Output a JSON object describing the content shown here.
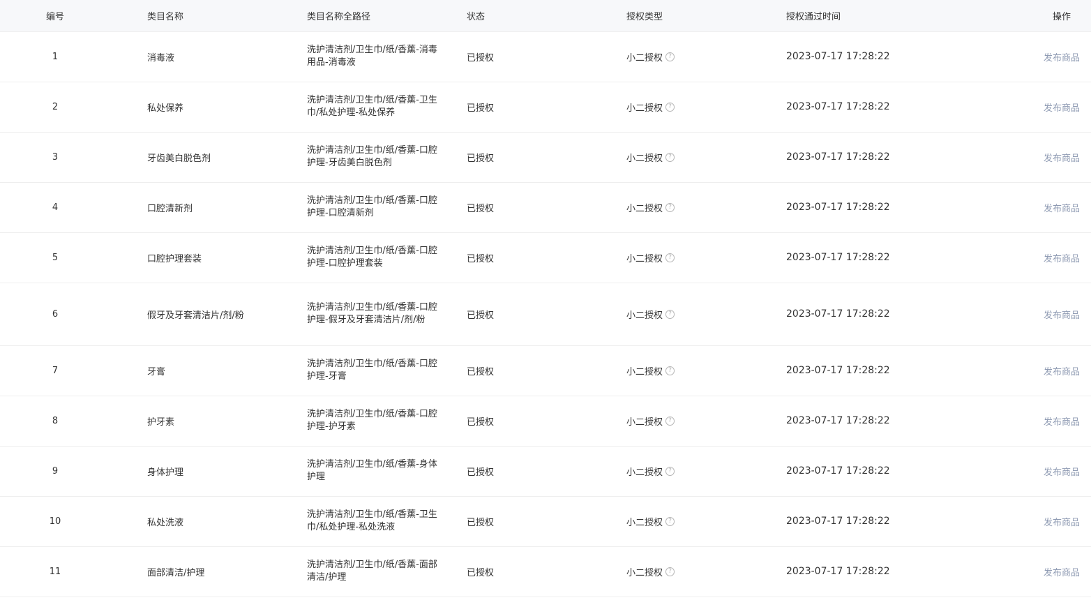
{
  "table": {
    "headers": {
      "no": "编号",
      "name": "类目名称",
      "path": "类目名称全路径",
      "status": "状态",
      "type": "授权类型",
      "time": "授权通过时间",
      "op": "操作"
    },
    "rows": [
      {
        "no": "1",
        "name": "消毒液",
        "path": "洗护清洁剂/卫生巾/纸/香薰-消毒用品-消毒液",
        "status": "已授权",
        "type": "小二授权",
        "time": "2023-07-17 17:28:22",
        "op": "发布商品"
      },
      {
        "no": "2",
        "name": "私处保养",
        "path": "洗护清洁剂/卫生巾/纸/香薰-卫生巾/私处护理-私处保养",
        "status": "已授权",
        "type": "小二授权",
        "time": "2023-07-17 17:28:22",
        "op": "发布商品"
      },
      {
        "no": "3",
        "name": "牙齿美白脱色剂",
        "path": "洗护清洁剂/卫生巾/纸/香薰-口腔护理-牙齿美白脱色剂",
        "status": "已授权",
        "type": "小二授权",
        "time": "2023-07-17 17:28:22",
        "op": "发布商品"
      },
      {
        "no": "4",
        "name": "口腔清新剂",
        "path": "洗护清洁剂/卫生巾/纸/香薰-口腔护理-口腔清新剂",
        "status": "已授权",
        "type": "小二授权",
        "time": "2023-07-17 17:28:22",
        "op": "发布商品"
      },
      {
        "no": "5",
        "name": "口腔护理套装",
        "path": "洗护清洁剂/卫生巾/纸/香薰-口腔护理-口腔护理套装",
        "status": "已授权",
        "type": "小二授权",
        "time": "2023-07-17 17:28:22",
        "op": "发布商品"
      },
      {
        "no": "6",
        "name": "假牙及牙套清洁片/剂/粉",
        "path": "洗护清洁剂/卫生巾/纸/香薰-口腔护理-假牙及牙套清洁片/剂/粉",
        "status": "已授权",
        "type": "小二授权",
        "time": "2023-07-17 17:28:22",
        "op": "发布商品"
      },
      {
        "no": "7",
        "name": "牙膏",
        "path": "洗护清洁剂/卫生巾/纸/香薰-口腔护理-牙膏",
        "status": "已授权",
        "type": "小二授权",
        "time": "2023-07-17 17:28:22",
        "op": "发布商品"
      },
      {
        "no": "8",
        "name": "护牙素",
        "path": "洗护清洁剂/卫生巾/纸/香薰-口腔护理-护牙素",
        "status": "已授权",
        "type": "小二授权",
        "time": "2023-07-17 17:28:22",
        "op": "发布商品"
      },
      {
        "no": "9",
        "name": "身体护理",
        "path": "洗护清洁剂/卫生巾/纸/香薰-身体护理",
        "status": "已授权",
        "type": "小二授权",
        "time": "2023-07-17 17:28:22",
        "op": "发布商品"
      },
      {
        "no": "10",
        "name": "私处洗液",
        "path": "洗护清洁剂/卫生巾/纸/香薰-卫生巾/私处护理-私处洗液",
        "status": "已授权",
        "type": "小二授权",
        "time": "2023-07-17 17:28:22",
        "op": "发布商品"
      },
      {
        "no": "11",
        "name": "面部清洁/护理",
        "path": "洗护清洁剂/卫生巾/纸/香薰-面部清洁/护理",
        "status": "已授权",
        "type": "小二授权",
        "time": "2023-07-17 17:28:22",
        "op": "发布商品"
      }
    ]
  },
  "icons": {
    "help": "question-circle-icon",
    "help_glyph": "?"
  },
  "colors": {
    "header_bg": "#f7f8fa",
    "link": "#8f9bb3",
    "border": "#eeeeee",
    "text": "#333333"
  }
}
